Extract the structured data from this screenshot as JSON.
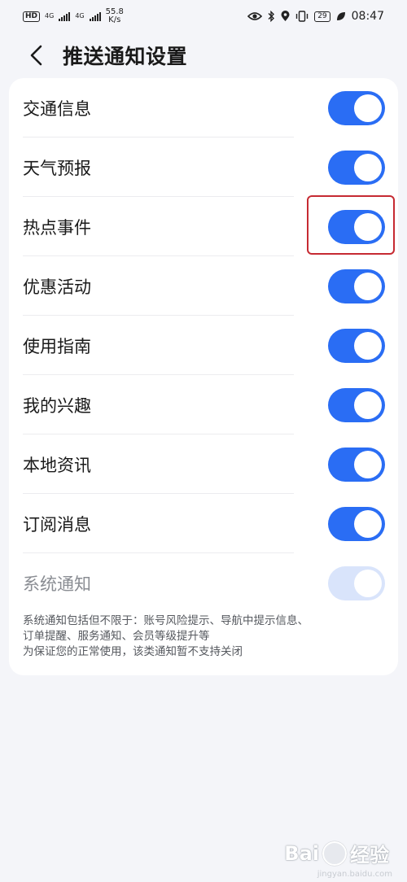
{
  "status_bar": {
    "hd_badge": "HD",
    "sim1_label": "4G",
    "sim2_label": "4G",
    "net_speed_value": "55.8",
    "net_speed_unit": "K/s",
    "battery": "29",
    "time": "08:47",
    "icons": [
      "eye-icon",
      "bluetooth-icon",
      "location-icon",
      "vibrate-icon",
      "battery-icon",
      "leaf-icon"
    ]
  },
  "header": {
    "back_icon": "chevron-left-icon",
    "title": "推送通知设置"
  },
  "settings": {
    "items": [
      {
        "label": "交通信息",
        "enabled": true,
        "disabled": false
      },
      {
        "label": "天气预报",
        "enabled": true,
        "disabled": false
      },
      {
        "label": "热点事件",
        "enabled": true,
        "disabled": false,
        "highlighted": true
      },
      {
        "label": "优惠活动",
        "enabled": true,
        "disabled": false
      },
      {
        "label": "使用指南",
        "enabled": true,
        "disabled": false
      },
      {
        "label": "我的兴趣",
        "enabled": true,
        "disabled": false
      },
      {
        "label": "本地资讯",
        "enabled": true,
        "disabled": false
      },
      {
        "label": "订阅消息",
        "enabled": true,
        "disabled": false
      },
      {
        "label": "系统通知",
        "enabled": true,
        "disabled": true
      }
    ],
    "note_line1": "系统通知包括但不限于：账号风险提示、导航中提示信息、",
    "note_line2": "订单提醒、服务通知、会员等级提升等",
    "note_line3": "为保证您的正常使用，该类通知暂不支持关闭"
  },
  "watermark": {
    "brand": "Bai",
    "suffix": "经验",
    "sub": "jingyan.baidu.com"
  },
  "colors": {
    "accent": "#2a6df4",
    "toggle_disabled": "#d9e4fb",
    "highlight_border": "#c62a32",
    "background": "#f4f5f9"
  }
}
